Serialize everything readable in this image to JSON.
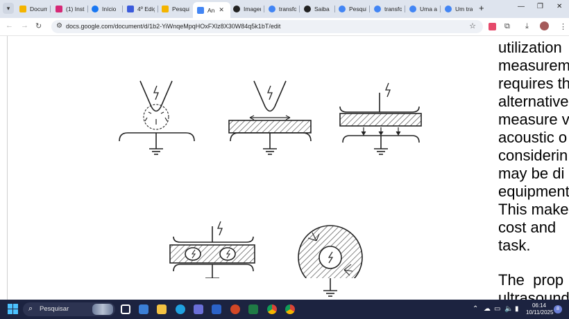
{
  "browser": {
    "tabs": [
      {
        "label": "Docum",
        "icon": "google-drive-icon",
        "color": "#f4b400"
      },
      {
        "label": "(1) Inst",
        "icon": "instagram-icon",
        "color": "#d62976"
      },
      {
        "label": "Início",
        "icon": "app-icon",
        "color": "#1877f2"
      },
      {
        "label": "4º Ediç",
        "icon": "app-icon",
        "color": "#3b5bdb"
      },
      {
        "label": "Pesqui",
        "icon": "google-drive-icon",
        "color": "#f4b400"
      },
      {
        "label": "An",
        "icon": "google-docs-icon",
        "color": "#4285f4",
        "active": true
      },
      {
        "label": "Imagen",
        "icon": "openai-icon",
        "color": "#222222"
      },
      {
        "label": "transfo",
        "icon": "google-icon",
        "color": "#4285f4"
      },
      {
        "label": "Saiba",
        "icon": "openai-icon",
        "color": "#222222"
      },
      {
        "label": "Pesqui",
        "icon": "google-icon",
        "color": "#4285f4"
      },
      {
        "label": "transfo",
        "icon": "google-icon",
        "color": "#4285f4"
      },
      {
        "label": "Uma ai",
        "icon": "google-icon",
        "color": "#4285f4"
      },
      {
        "label": "Um tra",
        "icon": "google-icon",
        "color": "#4285f4"
      }
    ],
    "url": "docs.google.com/document/d/1b2-YiWnqeMpqHOxFXlz8X30W84q5k1bT/edit"
  },
  "document": {
    "lines": [
      "utilization",
      "measurem",
      "requires th",
      "alternative",
      "measure v",
      "acoustic o",
      "considerin",
      "may be di",
      "equipment",
      "This make",
      "cost and",
      "task."
    ],
    "next_paragraph": [
      "The  prop",
      "ultrasound"
    ]
  },
  "taskbar": {
    "search_placeholder": "Pesquisar",
    "time": "06:14",
    "date": "10/11/2025",
    "notifications": "8"
  },
  "colors": {
    "tabbar": "#dee4ee",
    "taskbar": "#1c2340",
    "accent": "#4cc2ff"
  }
}
